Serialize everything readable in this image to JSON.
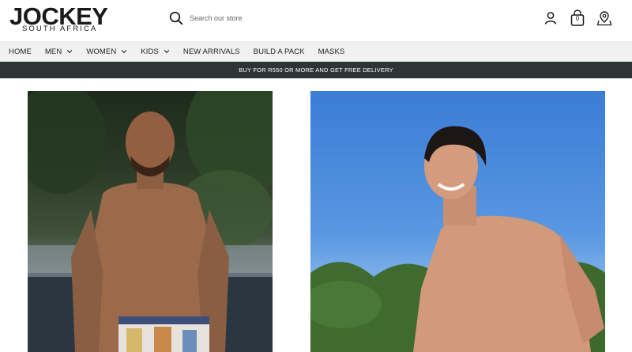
{
  "brand": {
    "name": "JOCKEY",
    "subtitle": "SOUTH AFRICA"
  },
  "search": {
    "placeholder": "Search our store"
  },
  "header_icons": [
    {
      "name": "account-icon"
    },
    {
      "name": "cart-icon",
      "count": "0"
    },
    {
      "name": "store-locator-icon"
    }
  ],
  "nav": {
    "items": [
      {
        "label": "HOME",
        "dropdown": false
      },
      {
        "label": "MEN",
        "dropdown": true
      },
      {
        "label": "WOMEN",
        "dropdown": true
      },
      {
        "label": "KIDS",
        "dropdown": true
      },
      {
        "label": "NEW ARRIVALS",
        "dropdown": false
      },
      {
        "label": "BUILD A PACK",
        "dropdown": false
      },
      {
        "label": "MASKS",
        "dropdown": false
      }
    ]
  },
  "promo": {
    "text": "BUY FOR R550 OR MORE AND GET FREE DELIVERY"
  },
  "colors": {
    "promo_bg": "#2f3537",
    "nav_bg": "#f1f1f1"
  }
}
